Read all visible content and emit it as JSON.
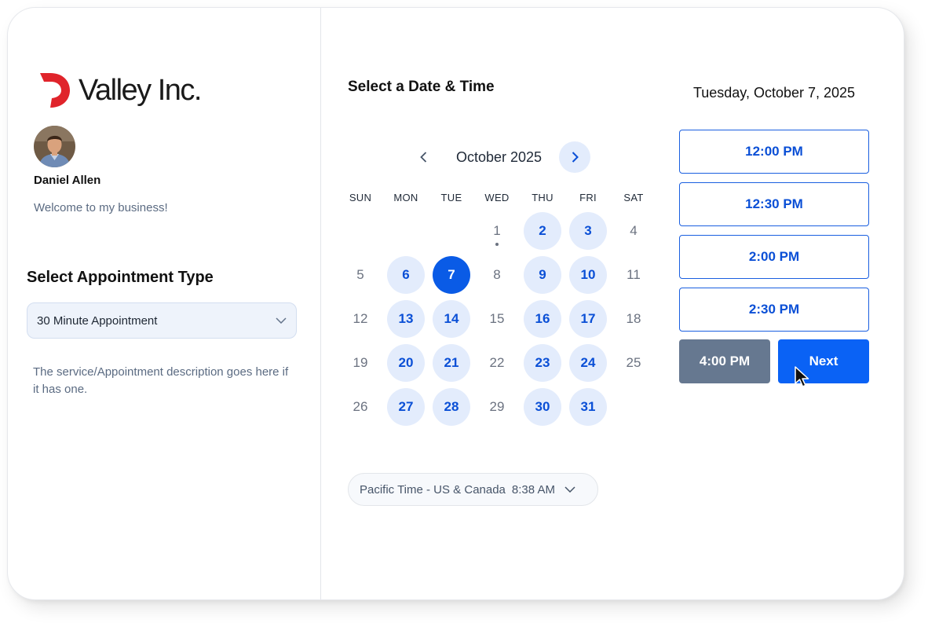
{
  "brand": {
    "name": "Valley Inc.",
    "logo_color": "#e0242b"
  },
  "host": {
    "name": "Daniel Allen",
    "welcome": "Welcome to my business!"
  },
  "appointment": {
    "title": "Select Appointment Type",
    "selected": "30 Minute Appointment",
    "description": "The service/Appointment description goes here if it has one."
  },
  "calendar": {
    "title": "Select a Date & Time",
    "month_label": "October 2025",
    "weekdays": [
      "SUN",
      "MON",
      "TUE",
      "WED",
      "THU",
      "FRI",
      "SAT"
    ],
    "weeks": [
      [
        null,
        null,
        null,
        {
          "d": "1",
          "s": "today"
        },
        {
          "d": "2",
          "s": "available"
        },
        {
          "d": "3",
          "s": "available"
        },
        {
          "d": "4",
          "s": "unavailable"
        }
      ],
      [
        {
          "d": "5",
          "s": "unavailable"
        },
        {
          "d": "6",
          "s": "available"
        },
        {
          "d": "7",
          "s": "selected"
        },
        {
          "d": "8",
          "s": "unavailable"
        },
        {
          "d": "9",
          "s": "available"
        },
        {
          "d": "10",
          "s": "available"
        },
        {
          "d": "11",
          "s": "unavailable"
        }
      ],
      [
        {
          "d": "12",
          "s": "unavailable"
        },
        {
          "d": "13",
          "s": "available"
        },
        {
          "d": "14",
          "s": "available"
        },
        {
          "d": "15",
          "s": "unavailable"
        },
        {
          "d": "16",
          "s": "available"
        },
        {
          "d": "17",
          "s": "available"
        },
        {
          "d": "18",
          "s": "unavailable"
        }
      ],
      [
        {
          "d": "19",
          "s": "unavailable"
        },
        {
          "d": "20",
          "s": "available"
        },
        {
          "d": "21",
          "s": "available"
        },
        {
          "d": "22",
          "s": "unavailable"
        },
        {
          "d": "23",
          "s": "available"
        },
        {
          "d": "24",
          "s": "available"
        },
        {
          "d": "25",
          "s": "unavailable"
        }
      ],
      [
        {
          "d": "26",
          "s": "unavailable"
        },
        {
          "d": "27",
          "s": "available"
        },
        {
          "d": "28",
          "s": "available"
        },
        {
          "d": "29",
          "s": "unavailable"
        },
        {
          "d": "30",
          "s": "available"
        },
        {
          "d": "31",
          "s": "available"
        },
        null
      ]
    ]
  },
  "timezone": {
    "name": "Pacific Time - US & Canada",
    "time": "8:38 AM"
  },
  "slots": {
    "date_label": "Tuesday, October 7, 2025",
    "times": [
      "12:00 PM",
      "12:30 PM",
      "2:00 PM",
      "2:30 PM"
    ],
    "selected_time": "4:00 PM",
    "next_label": "Next"
  },
  "colors": {
    "accent": "#0a5be6",
    "available_bg": "#e3ecfc",
    "selected_slot_bg": "#667890"
  }
}
